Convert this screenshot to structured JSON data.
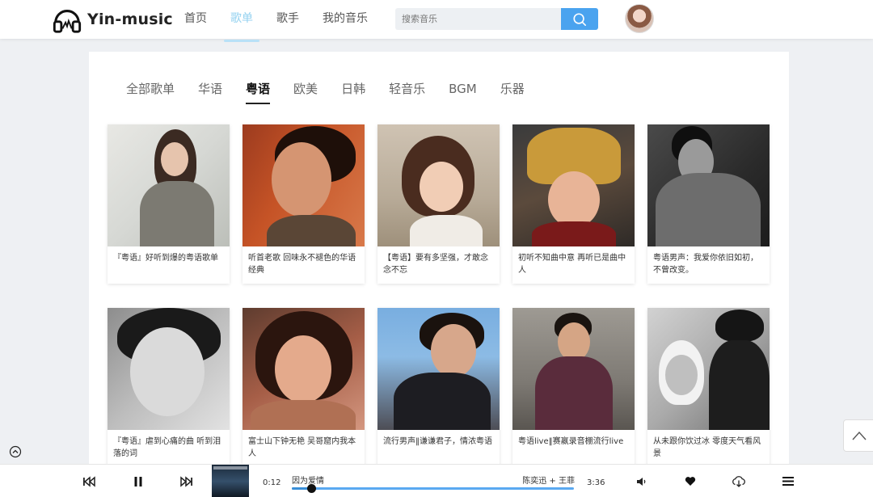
{
  "header": {
    "logo_text": "Yin-music",
    "nav": [
      {
        "label": "首页",
        "active": false
      },
      {
        "label": "歌单",
        "active": true
      },
      {
        "label": "歌手",
        "active": false
      },
      {
        "label": "我的音乐",
        "active": false
      }
    ],
    "search": {
      "placeholder": "搜索音乐",
      "icon": "search-icon"
    },
    "avatar_icon": "user-avatar"
  },
  "tabs": [
    {
      "label": "全部歌单",
      "active": false
    },
    {
      "label": "华语",
      "active": false
    },
    {
      "label": "粤语",
      "active": true
    },
    {
      "label": "欧美",
      "active": false
    },
    {
      "label": "日韩",
      "active": false
    },
    {
      "label": "轻音乐",
      "active": false
    },
    {
      "label": "BGM",
      "active": false
    },
    {
      "label": "乐器",
      "active": false
    }
  ],
  "playlists": [
    {
      "title": "『粤语』好听到爆的粤语歌单"
    },
    {
      "title": "听首老歌 回味永不褪色的华语经典"
    },
    {
      "title": "【粤语】要有多坚强，才敢念念不忘"
    },
    {
      "title": "初听不知曲中意 再听已是曲中人"
    },
    {
      "title": "粤语男声：我爱你依旧如初，不曾改变。"
    },
    {
      "title": "『粤语』虐到心痛的曲 听到泪落的词"
    },
    {
      "title": "富士山下钟无艳 吴哥窟内我本人"
    },
    {
      "title": "流行男声‖谦谦君子，情浓粤语"
    },
    {
      "title": "粤语live‖赛嬴录音棚流行live"
    },
    {
      "title": "从未跟你饮过冰 零度天气看风景"
    }
  ],
  "player": {
    "current_time": "0:12",
    "total_time": "3:36",
    "song_name": "因为爱情",
    "singer": "陈奕迅 + 王菲",
    "progress": 0.07,
    "icons": [
      "prev-icon",
      "pause-icon",
      "next-icon",
      "volume-icon",
      "heart-icon",
      "download-icon",
      "playlist-icon"
    ]
  },
  "colors": {
    "accent": "#4aa3ef",
    "nav_active": "#95d2f0",
    "background": "#eef0f3"
  }
}
